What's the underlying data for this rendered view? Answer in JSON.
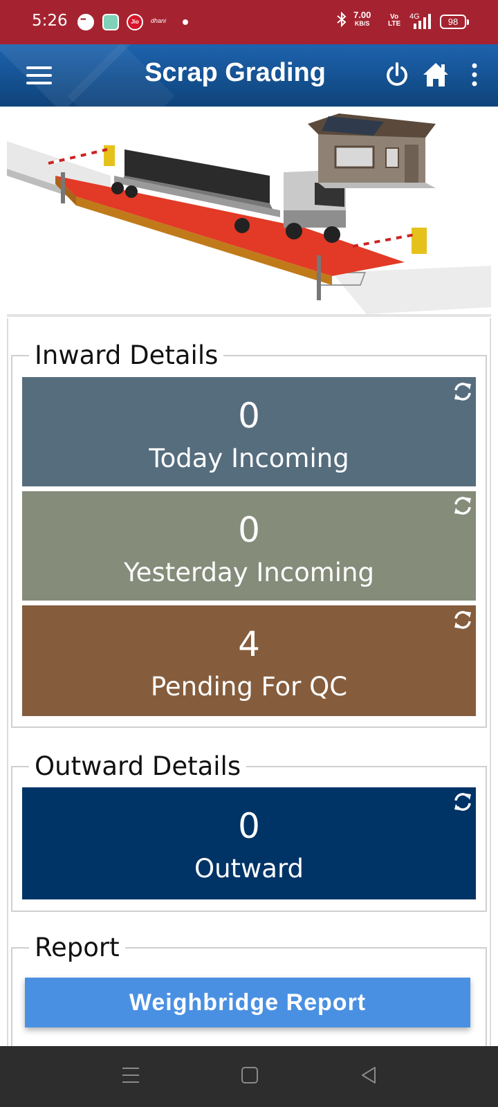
{
  "status_bar": {
    "time": "5:26",
    "jio_label": "Jio",
    "dhani_label": "dhani",
    "speed_value": "7.00",
    "speed_unit": "KB/S",
    "volte_top": "Vo",
    "volte_bottom": "LTE",
    "network": "4G",
    "battery": "98",
    "icons": [
      "message-icon",
      "app-icon",
      "jio-icon",
      "dhani-icon",
      "notification-dot-icon",
      "bluetooth-icon",
      "signal-icon",
      "battery-icon"
    ]
  },
  "header": {
    "title": "Scrap Grading",
    "icons": [
      "menu-icon",
      "power-icon",
      "home-icon",
      "kebab-menu-icon"
    ],
    "accent_color": "#1e63ae"
  },
  "banner": {
    "image": "weighbridge-truck-illustration"
  },
  "inward": {
    "title": "Inward Details",
    "tiles": [
      {
        "value": "0",
        "label": "Today Incoming",
        "color": "#566d7e"
      },
      {
        "value": "0",
        "label": "Yesterday Incoming",
        "color": "#858c7a"
      },
      {
        "value": "4",
        "label": "Pending For QC",
        "color": "#855d3d"
      }
    ]
  },
  "outward": {
    "title": "Outward Details",
    "tiles": [
      {
        "value": "0",
        "label": "Outward",
        "color": "#003366"
      }
    ]
  },
  "report": {
    "title": "Report",
    "button_label": "Weighbridge Report",
    "button_color": "#4a90e2"
  },
  "navbar": {
    "icons": [
      "recents-icon",
      "home-nav-icon",
      "back-icon"
    ]
  }
}
